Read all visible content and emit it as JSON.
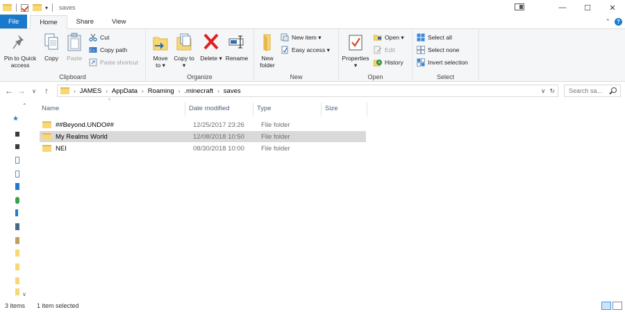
{
  "window": {
    "title": "saves"
  },
  "tabs": [
    {
      "label": "File"
    },
    {
      "label": "Home"
    },
    {
      "label": "Share"
    },
    {
      "label": "View"
    }
  ],
  "ribbon": {
    "clipboard": {
      "label": "Clipboard",
      "pin": "Pin to Quick access",
      "copy": "Copy",
      "paste": "Paste",
      "cut": "Cut",
      "copy_path": "Copy path",
      "paste_shortcut": "Paste shortcut"
    },
    "organize": {
      "label": "Organize",
      "move_to": "Move to ▾",
      "copy_to": "Copy to ▾",
      "delete": "Delete ▾",
      "rename": "Rename"
    },
    "new": {
      "label": "New",
      "new_folder": "New folder",
      "new_item": "New item ▾",
      "easy_access": "Easy access ▾"
    },
    "open": {
      "label": "Open",
      "properties": "Properties ▾",
      "open": "Open ▾",
      "edit": "Edit",
      "history": "History"
    },
    "select": {
      "label": "Select",
      "select_all": "Select all",
      "select_none": "Select none",
      "invert": "Invert selection"
    }
  },
  "address": {
    "crumbs": [
      "JAMES",
      "AppData",
      "Roaming",
      ".minecraft",
      "saves"
    ],
    "search_placeholder": "Search sa..."
  },
  "columns": {
    "name": "Name",
    "date": "Date modified",
    "type": "Type",
    "size": "Size"
  },
  "files": [
    {
      "name": "##Beyond.UNDO##",
      "date": "12/25/2017 23:26",
      "type": "File folder",
      "selected": false
    },
    {
      "name": "My Realms World",
      "date": "12/08/2018 10:50",
      "type": "File folder",
      "selected": true
    },
    {
      "name": "NEI",
      "date": "08/30/2018 10:00",
      "type": "File folder",
      "selected": false
    }
  ],
  "status": {
    "count": "3 items",
    "selected": "1 item selected"
  },
  "colors": {
    "accent": "#1979ca",
    "folder": "#f8d775",
    "selection": "#d9d9d9"
  }
}
